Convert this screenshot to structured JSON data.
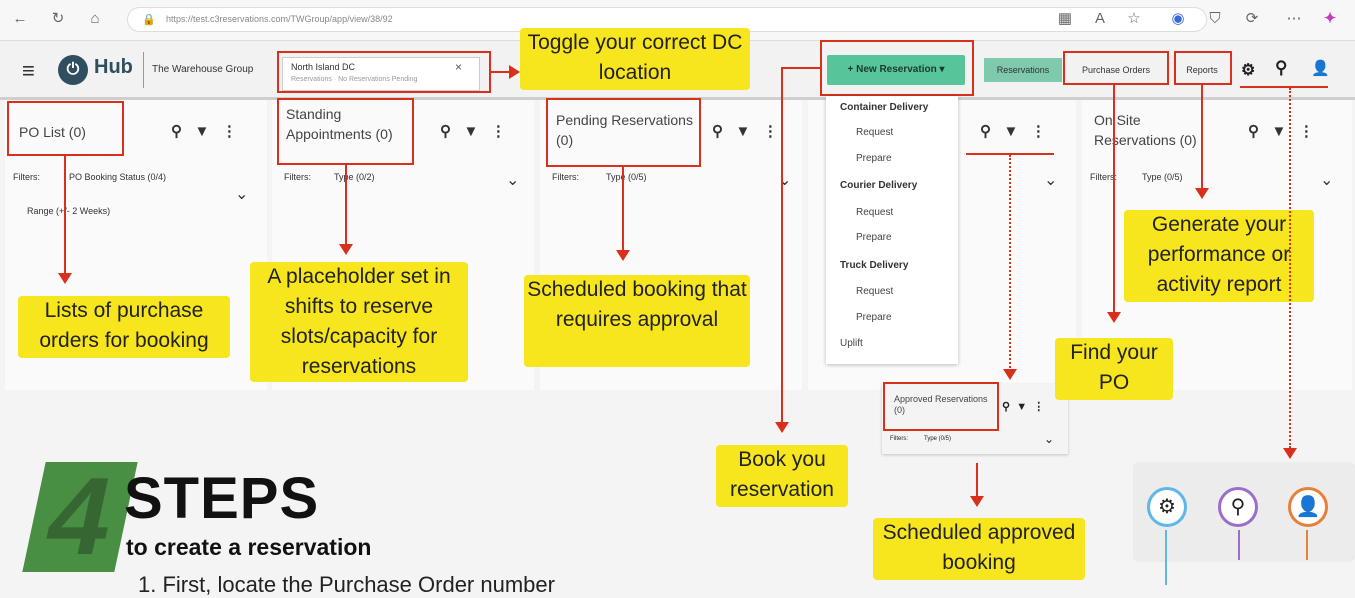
{
  "browser": {
    "url": "https://test.c3reservations.com/TWGroup/app/view/38/92",
    "nav_icons": [
      "back-icon",
      "refresh-icon",
      "home-icon"
    ]
  },
  "header": {
    "hub_label": "Hub",
    "company": "The Warehouse Group",
    "dc_location": "North Island DC",
    "dc_subtext": "Reservations · No Reservations Pending",
    "dc_clear": "×",
    "new_reservation": "+ New Reservation ▾",
    "nav": [
      "Reservations",
      "Purchase Orders",
      "Reports"
    ]
  },
  "panels": {
    "po_list": {
      "title": "PO List (0)",
      "filters_label": "Filters:",
      "filter1": "PO Booking Status (0/4)",
      "filter2": "Range (+/- 2 Weeks)"
    },
    "standing": {
      "title": "Standing Appointments (0)",
      "filters_label": "Filters:",
      "filter1": "Type (0/2)"
    },
    "pending": {
      "title": "Pending Reservations (0)",
      "filters_label": "Filters:",
      "filter1": "Type (0/5)"
    },
    "onsite": {
      "title": "On Site Reservations (0)",
      "filters_label": "Filters:",
      "filter1": "Type (0/5)"
    },
    "approved": {
      "title": "Approved Reservations (0)",
      "filters_label": "Filters:",
      "filter1": "Type (0/5)"
    }
  },
  "menu": {
    "groups": [
      {
        "head": "Container Delivery",
        "items": [
          "Request",
          "Prepare"
        ]
      },
      {
        "head": "Courier Delivery",
        "items": [
          "Request",
          "Prepare"
        ]
      },
      {
        "head": "Truck Delivery",
        "items": [
          "Request",
          "Prepare"
        ]
      }
    ],
    "uplift": "Uplift"
  },
  "callouts": {
    "toggle_dc": "Toggle your correct DC location",
    "lists_po": "Lists of purchase orders for booking",
    "placeholder": "A placeholder  set in shifts to reserve slots/capacity for reservations",
    "scheduled_pending": "Scheduled booking that requires approval",
    "book": "Book you reservation",
    "find_po": "Find your PO",
    "generate_report": "Generate your performance or activity report",
    "scheduled_approved": "Scheduled approved booking"
  },
  "steps": {
    "big_number": "4",
    "title": "STEPS",
    "subtitle": "to create a reservation",
    "step1_partial": "1. First, locate the Purchase Order number"
  },
  "colors": {
    "accent_red": "#d9301b",
    "callout_yellow": "#f7e51d",
    "new_res_green": "#57c49a",
    "logo_green": "#3f8a3a"
  }
}
